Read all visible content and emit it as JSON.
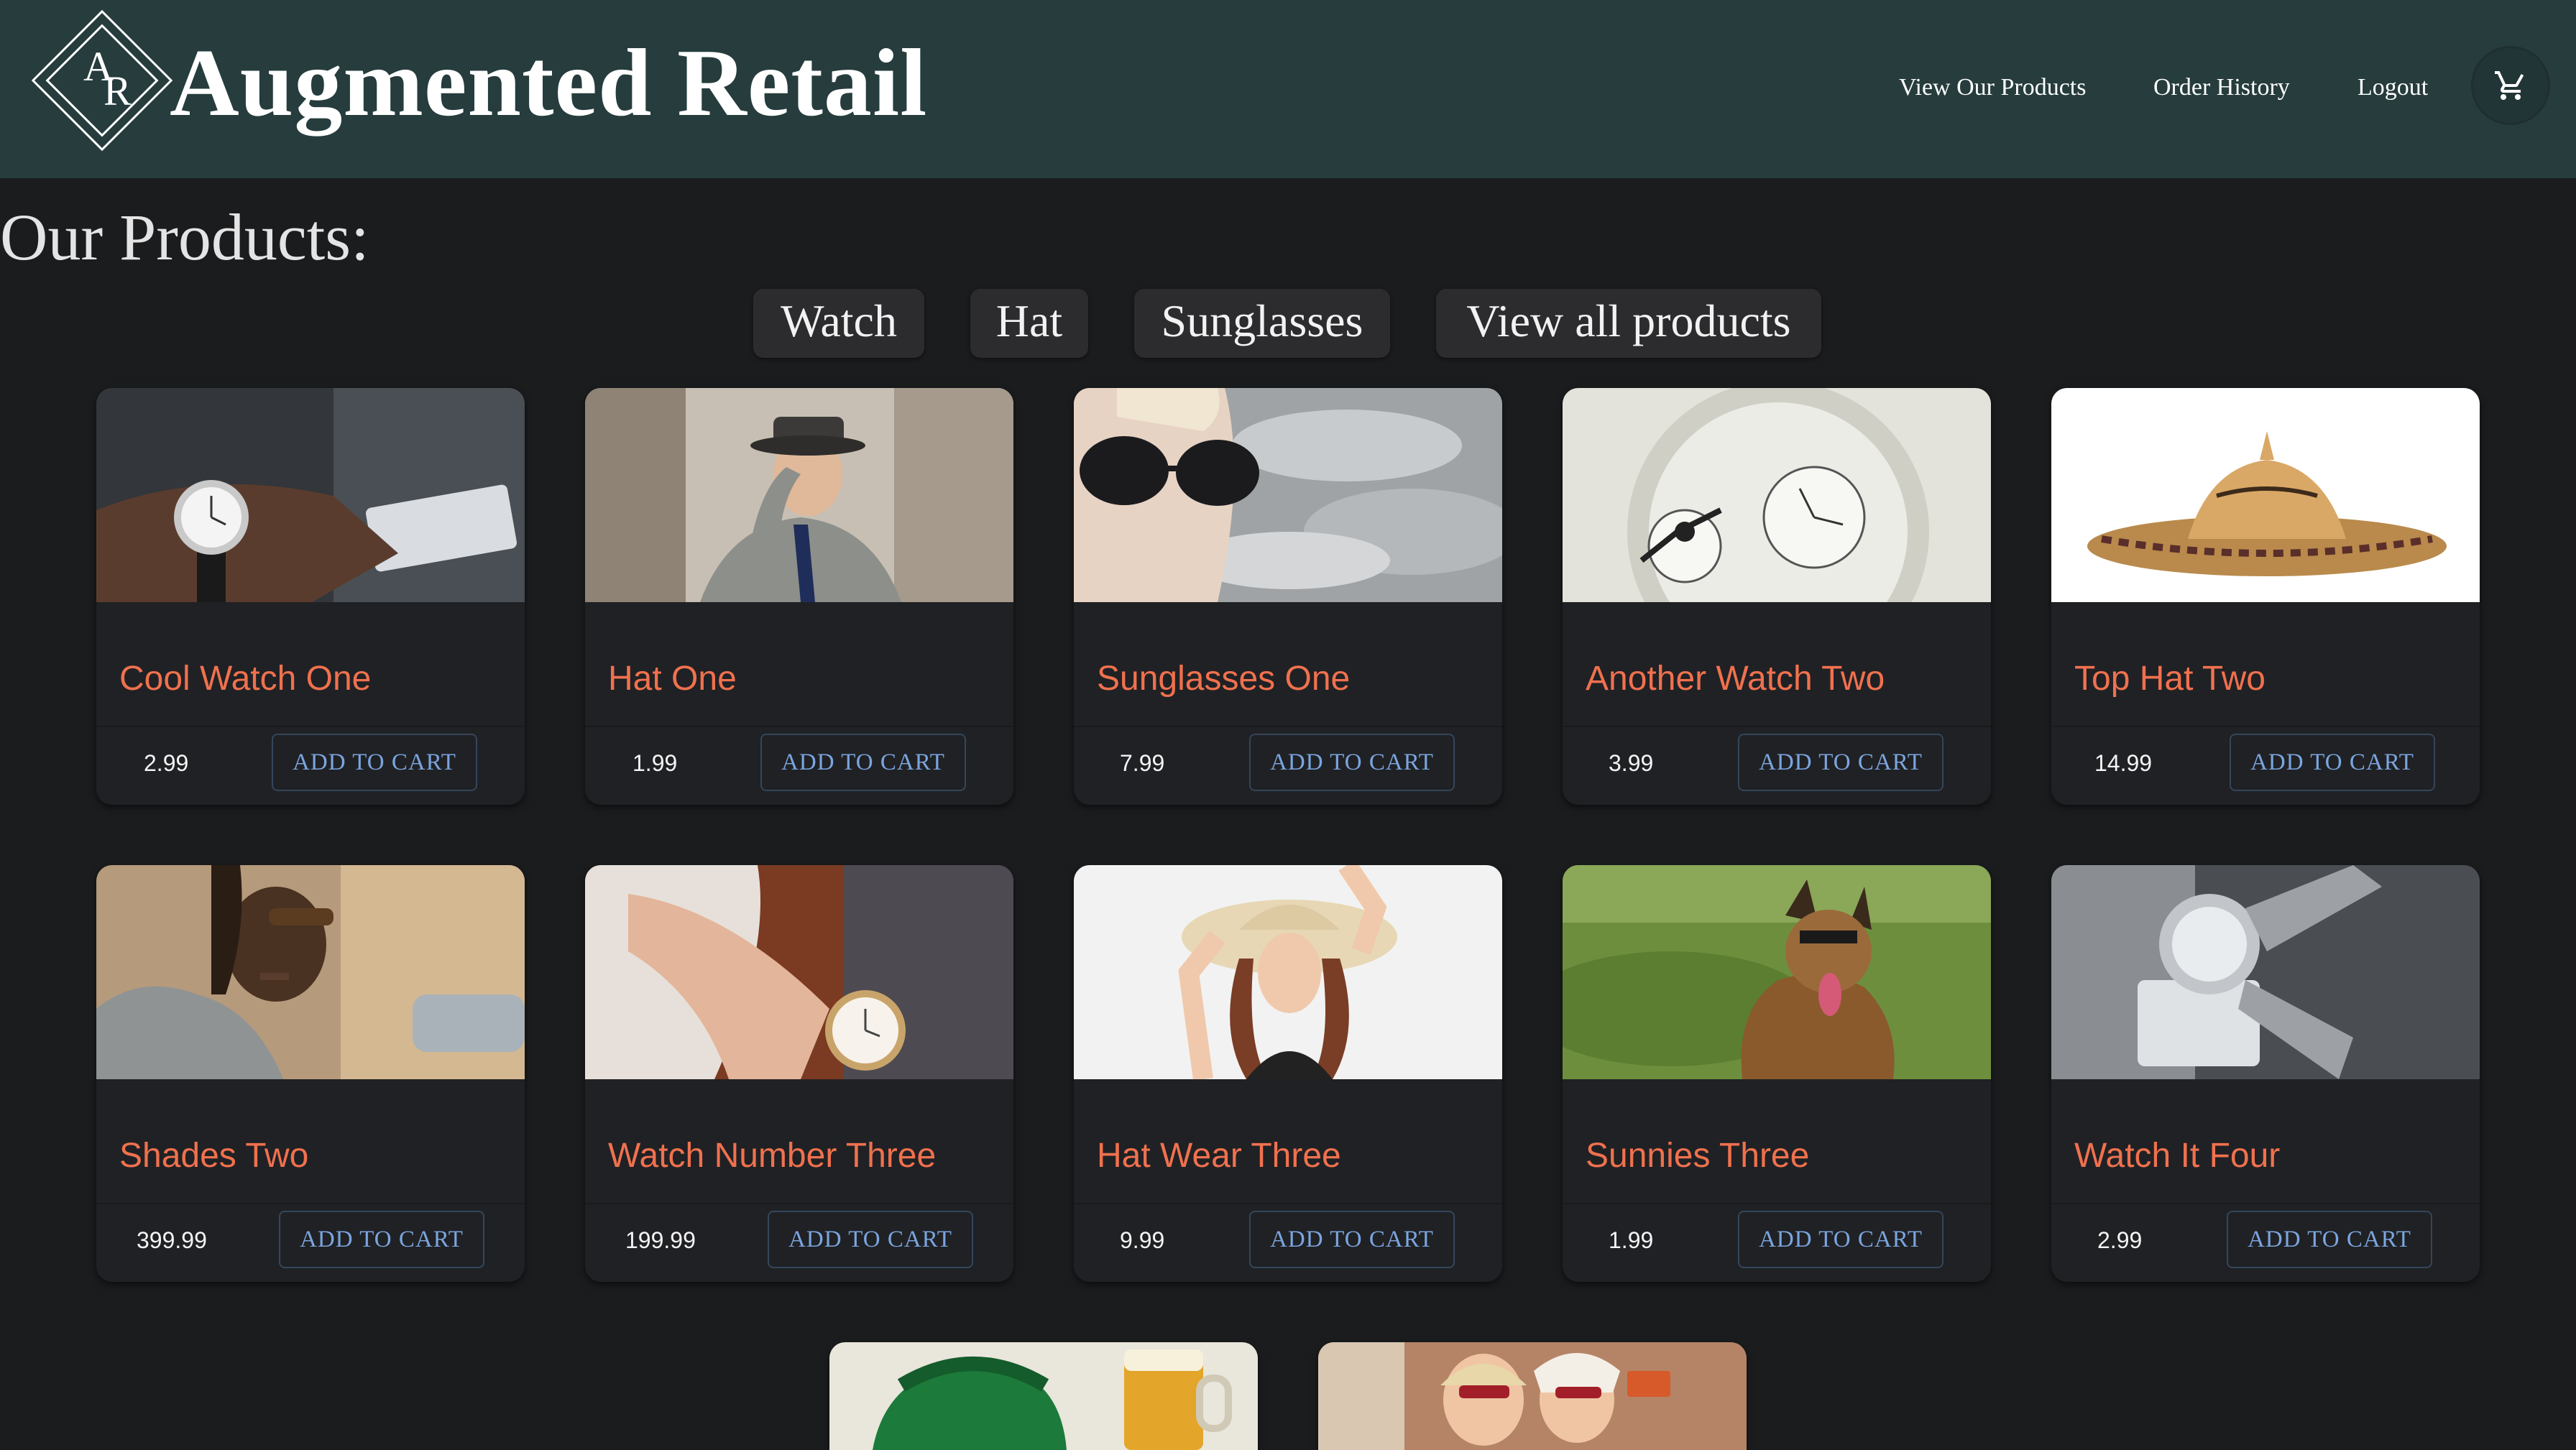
{
  "header": {
    "logo_text": "AR",
    "brand": "Augmented Retail",
    "nav": [
      "View Our Products",
      "Order History",
      "Logout"
    ],
    "cart_icon": "cart-icon"
  },
  "page_title": "Our Products:",
  "filters": [
    "Watch",
    "Hat",
    "Sunglasses",
    "View all products"
  ],
  "add_to_cart_label": "ADD TO CART",
  "products": [
    {
      "name": "Cool Watch One",
      "price": "2.99"
    },
    {
      "name": "Hat One",
      "price": "1.99"
    },
    {
      "name": "Sunglasses One",
      "price": "7.99"
    },
    {
      "name": "Another Watch Two",
      "price": "3.99"
    },
    {
      "name": "Top Hat Two",
      "price": "14.99"
    },
    {
      "name": "Shades Two",
      "price": "399.99"
    },
    {
      "name": "Watch Number Three",
      "price": "199.99"
    },
    {
      "name": "Hat Wear Three",
      "price": "9.99"
    },
    {
      "name": "Sunnies Three",
      "price": "1.99"
    },
    {
      "name": "Watch It Four",
      "price": "2.99"
    }
  ],
  "colors": {
    "header_bg": "#263c3d",
    "page_bg": "#1b1c1e",
    "card_bg": "#202124",
    "title_accent": "#f0714e",
    "button_text": "#7ba5e0"
  }
}
